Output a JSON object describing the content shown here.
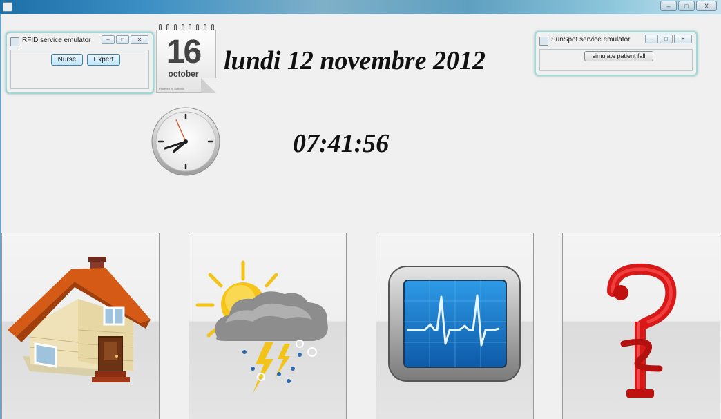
{
  "main_window": {
    "buttons": {
      "minimize": "–",
      "maximize": "□",
      "close": "X"
    }
  },
  "rfid_window": {
    "title": "RFID service emulator",
    "controls": {
      "minimize": "–",
      "maximize": "□",
      "close": "✕"
    },
    "buttons": {
      "nurse": "Nurse",
      "expert": "Expert"
    }
  },
  "sunspot_window": {
    "title": "SunSpot service emulator",
    "controls": {
      "minimize": "–",
      "maximize": "□",
      "close": "✕"
    },
    "buttons": {
      "simulate_fall": "simulate patient fall"
    }
  },
  "calendar": {
    "day": "16",
    "month": "october",
    "footer": "Powered by Softonic"
  },
  "date": {
    "text": "lundi 12 novembre 2012"
  },
  "clock": {
    "time": "07:41:56",
    "hour": 7,
    "minute": 41,
    "second": 56
  },
  "tiles": [
    {
      "id": "home",
      "icon": "house-icon"
    },
    {
      "id": "weather",
      "icon": "weather-storm-icon"
    },
    {
      "id": "monitor",
      "icon": "heart-monitor-icon"
    },
    {
      "id": "medical",
      "icon": "medical-symbol-icon"
    }
  ],
  "colors": {
    "emulator_border": "#9fd8d6",
    "button_border": "#3c7fb1",
    "medical_red": "#e01b1b",
    "monitor_blue": "#1a7bd0"
  }
}
